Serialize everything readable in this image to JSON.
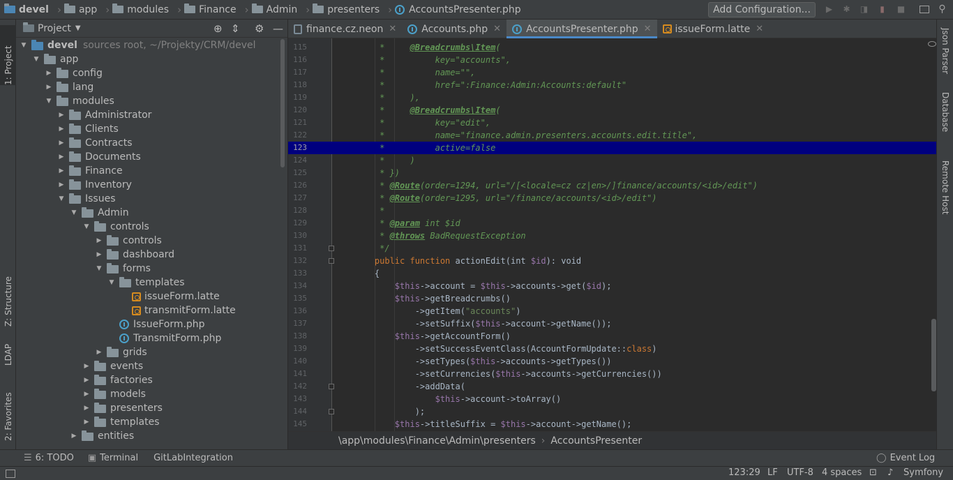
{
  "breadcrumb": {
    "items": [
      "devel",
      "app",
      "modules",
      "Finance",
      "Admin",
      "presenters",
      "AccountsPresenter.php"
    ]
  },
  "toolbar": {
    "add_configuration": "Add Configuration..."
  },
  "left_tool_tabs": {
    "project": "1: Project",
    "structure": "Z: Structure",
    "ldap": "LDAP",
    "favorites": "2: Favorites"
  },
  "right_tool_tabs": {
    "json_parser": "Json Parser",
    "database": "Database",
    "remote_host": "Remote Host"
  },
  "project_panel": {
    "title": "Project",
    "root": {
      "name": "devel",
      "subtitle": "sources root, ~/Projekty/CRM/devel"
    },
    "tree": [
      {
        "label": "app",
        "depth": 1,
        "type": "folder",
        "open": true
      },
      {
        "label": "config",
        "depth": 2,
        "type": "folder",
        "open": false
      },
      {
        "label": "lang",
        "depth": 2,
        "type": "folder",
        "open": false
      },
      {
        "label": "modules",
        "depth": 2,
        "type": "folder",
        "open": true
      },
      {
        "label": "Administrator",
        "depth": 3,
        "type": "folder",
        "open": false
      },
      {
        "label": "Clients",
        "depth": 3,
        "type": "folder",
        "open": false
      },
      {
        "label": "Contracts",
        "depth": 3,
        "type": "folder",
        "open": false
      },
      {
        "label": "Documents",
        "depth": 3,
        "type": "folder",
        "open": false
      },
      {
        "label": "Finance",
        "depth": 3,
        "type": "folder",
        "open": false
      },
      {
        "label": "Inventory",
        "depth": 3,
        "type": "folder",
        "open": false
      },
      {
        "label": "Issues",
        "depth": 3,
        "type": "folder",
        "open": true
      },
      {
        "label": "Admin",
        "depth": 4,
        "type": "folder",
        "open": true
      },
      {
        "label": "controls",
        "depth": 5,
        "type": "folder",
        "open": true
      },
      {
        "label": "controls",
        "depth": 6,
        "type": "folder",
        "open": false
      },
      {
        "label": "dashboard",
        "depth": 6,
        "type": "folder",
        "open": false
      },
      {
        "label": "forms",
        "depth": 6,
        "type": "folder",
        "open": true
      },
      {
        "label": "templates",
        "depth": 7,
        "type": "folder",
        "open": true
      },
      {
        "label": "issueForm.latte",
        "depth": 8,
        "type": "latte"
      },
      {
        "label": "transmitForm.latte",
        "depth": 8,
        "type": "latte"
      },
      {
        "label": "IssueForm.php",
        "depth": 7,
        "type": "php"
      },
      {
        "label": "TransmitForm.php",
        "depth": 7,
        "type": "php"
      },
      {
        "label": "grids",
        "depth": 6,
        "type": "folder",
        "open": false
      },
      {
        "label": "events",
        "depth": 5,
        "type": "folder",
        "open": false
      },
      {
        "label": "factories",
        "depth": 5,
        "type": "folder",
        "open": false
      },
      {
        "label": "models",
        "depth": 5,
        "type": "folder",
        "open": false
      },
      {
        "label": "presenters",
        "depth": 5,
        "type": "folder",
        "open": false
      },
      {
        "label": "templates",
        "depth": 5,
        "type": "folder",
        "open": false
      },
      {
        "label": "entities",
        "depth": 4,
        "type": "folder",
        "open": false
      }
    ]
  },
  "editor_tabs": [
    {
      "label": "finance.cz.neon",
      "icon": "neon",
      "active": false
    },
    {
      "label": "Accounts.php",
      "icon": "php",
      "active": false
    },
    {
      "label": "AccountsPresenter.php",
      "icon": "php",
      "active": true
    },
    {
      "label": "issueForm.latte",
      "icon": "latte",
      "active": false
    }
  ],
  "editor": {
    "highlighted_line": 123,
    "lines": [
      {
        "n": 115,
        "tokens": [
          [
            "cm",
            "     *     "
          ],
          [
            "an",
            "@Breadcrumbs\\Item"
          ],
          [
            "cm",
            "("
          ]
        ]
      },
      {
        "n": 116,
        "tokens": [
          [
            "cm",
            "     *          key=\"accounts\","
          ]
        ]
      },
      {
        "n": 117,
        "tokens": [
          [
            "cm",
            "     *          name=\"\","
          ]
        ]
      },
      {
        "n": 118,
        "tokens": [
          [
            "cm",
            "     *          href=\":Finance:Admin:Accounts:default\""
          ]
        ]
      },
      {
        "n": 119,
        "tokens": [
          [
            "cm",
            "     *     ),"
          ]
        ]
      },
      {
        "n": 120,
        "tokens": [
          [
            "cm",
            "     *     "
          ],
          [
            "an",
            "@Breadcrumbs\\Item"
          ],
          [
            "cm",
            "("
          ]
        ]
      },
      {
        "n": 121,
        "tokens": [
          [
            "cm",
            "     *          key=\"edit\","
          ]
        ]
      },
      {
        "n": 122,
        "tokens": [
          [
            "cm",
            "     *          name=\"finance.admin.presenters.accounts.edit.title\","
          ]
        ]
      },
      {
        "n": 123,
        "tokens": [
          [
            "cm",
            "     *          active=false"
          ]
        ]
      },
      {
        "n": 124,
        "tokens": [
          [
            "cm",
            "     *     )"
          ]
        ]
      },
      {
        "n": 125,
        "tokens": [
          [
            "cm",
            "     * })"
          ]
        ]
      },
      {
        "n": 126,
        "tokens": [
          [
            "cm",
            "     * "
          ],
          [
            "an",
            "@Route"
          ],
          [
            "cm",
            "(order=1294, url=\"/[<locale=cz cz|en>/]finance/accounts/<id>/edit\")"
          ]
        ]
      },
      {
        "n": 127,
        "tokens": [
          [
            "cm",
            "     * "
          ],
          [
            "an",
            "@Route"
          ],
          [
            "cm",
            "(order=1295, url=\"/finance/accounts/<id>/edit\")"
          ]
        ]
      },
      {
        "n": 128,
        "tokens": [
          [
            "cm",
            "     *"
          ]
        ]
      },
      {
        "n": 129,
        "tokens": [
          [
            "cm",
            "     * "
          ],
          [
            "an",
            "@param"
          ],
          [
            "cm",
            " int $id"
          ]
        ]
      },
      {
        "n": 130,
        "tokens": [
          [
            "cm",
            "     * "
          ],
          [
            "an",
            "@throws"
          ],
          [
            "cm",
            " BadRequestException"
          ]
        ]
      },
      {
        "n": 131,
        "tokens": [
          [
            "cm",
            "     */"
          ]
        ]
      },
      {
        "n": 132,
        "tokens": [
          [
            "pl",
            "    "
          ],
          [
            "kw",
            "public function "
          ],
          [
            "pl",
            "actionEdit(int "
          ],
          [
            "va",
            "$id"
          ],
          [
            "pl",
            "): void"
          ]
        ]
      },
      {
        "n": 133,
        "tokens": [
          [
            "pl",
            "    {"
          ]
        ]
      },
      {
        "n": 134,
        "tokens": [
          [
            "pl",
            "        "
          ],
          [
            "va",
            "$this"
          ],
          [
            "pl",
            "->account = "
          ],
          [
            "va",
            "$this"
          ],
          [
            "pl",
            "->accounts->get("
          ],
          [
            "va",
            "$id"
          ],
          [
            "pl",
            ");"
          ]
        ]
      },
      {
        "n": 135,
        "tokens": [
          [
            "pl",
            "        "
          ],
          [
            "va",
            "$this"
          ],
          [
            "pl",
            "->getBreadcrumbs()"
          ]
        ]
      },
      {
        "n": 136,
        "tokens": [
          [
            "pl",
            "            ->getItem("
          ],
          [
            "st",
            "\"accounts\""
          ],
          [
            "pl",
            ")"
          ]
        ]
      },
      {
        "n": 137,
        "tokens": [
          [
            "pl",
            "            ->setSuffix("
          ],
          [
            "va",
            "$this"
          ],
          [
            "pl",
            "->account->getName());"
          ]
        ]
      },
      {
        "n": 138,
        "tokens": [
          [
            "pl",
            "        "
          ],
          [
            "va",
            "$this"
          ],
          [
            "pl",
            "->getAccountForm()"
          ]
        ]
      },
      {
        "n": 139,
        "tokens": [
          [
            "pl",
            "            ->setSuccessEventClass(AccountFormUpdate::"
          ],
          [
            "kw",
            "class"
          ],
          [
            "pl",
            ")"
          ]
        ]
      },
      {
        "n": 140,
        "tokens": [
          [
            "pl",
            "            ->setTypes("
          ],
          [
            "va",
            "$this"
          ],
          [
            "pl",
            "->accounts->getTypes())"
          ]
        ]
      },
      {
        "n": 141,
        "tokens": [
          [
            "pl",
            "            ->setCurrencies("
          ],
          [
            "va",
            "$this"
          ],
          [
            "pl",
            "->accounts->getCurrencies())"
          ]
        ]
      },
      {
        "n": 142,
        "tokens": [
          [
            "pl",
            "            ->addData("
          ]
        ]
      },
      {
        "n": 143,
        "tokens": [
          [
            "pl",
            "                "
          ],
          [
            "va",
            "$this"
          ],
          [
            "pl",
            "->account->toArray()"
          ]
        ]
      },
      {
        "n": 144,
        "tokens": [
          [
            "pl",
            "            );"
          ]
        ]
      },
      {
        "n": 145,
        "tokens": [
          [
            "pl",
            "        "
          ],
          [
            "va",
            "$this"
          ],
          [
            "pl",
            "->titleSuffix = "
          ],
          [
            "va",
            "$this"
          ],
          [
            "pl",
            "->account->getName();"
          ]
        ]
      }
    ]
  },
  "editor_breadcrumb": {
    "path": "\\app\\modules\\Finance\\Admin\\presenters",
    "cls": "AccountsPresenter"
  },
  "tool_windows": {
    "todo": "6: TODO",
    "terminal": "Terminal",
    "gitlab": "GitLabIntegration",
    "event_log": "Event Log"
  },
  "status_bar": {
    "position": "123:29",
    "line_sep": "LF",
    "encoding": "UTF-8",
    "indent": "4 spaces",
    "framework": "Symfony"
  },
  "colors": {
    "highlight_line": "#00007f",
    "comment": "#629755",
    "keyword": "#cc7832",
    "variable": "#9876aa",
    "string": "#6a8759"
  }
}
